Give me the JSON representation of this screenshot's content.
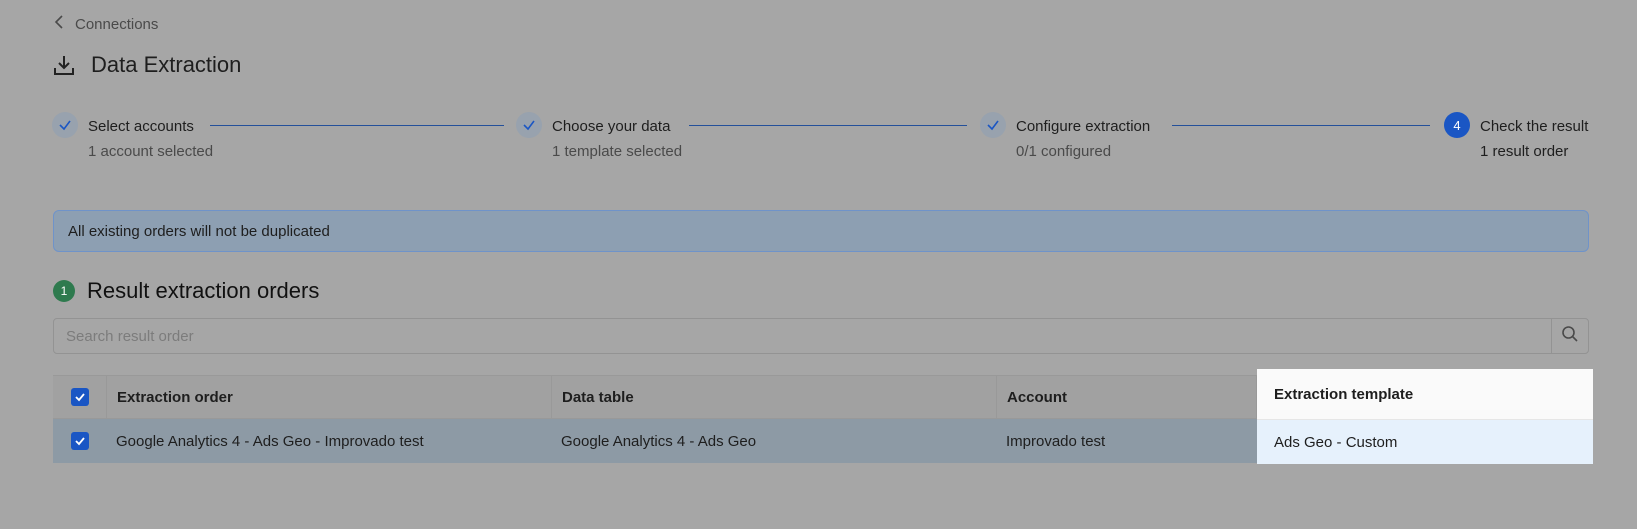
{
  "breadcrumb": {
    "back_label": "Connections"
  },
  "page": {
    "title": "Data Extraction"
  },
  "steps": [
    {
      "label": "Select accounts",
      "sub": "1 account selected",
      "status": "done"
    },
    {
      "label": "Choose your data",
      "sub": "1 template selected",
      "status": "done"
    },
    {
      "label": "Configure extraction",
      "sub": "0/1 configured",
      "status": "done"
    },
    {
      "label": "Check the result",
      "sub": "1 result order",
      "status": "current",
      "number": "4"
    }
  ],
  "notice": {
    "text": "All existing orders will not be duplicated"
  },
  "section": {
    "count": "1",
    "title": "Result extraction orders"
  },
  "search": {
    "placeholder": "Search result order",
    "value": ""
  },
  "table": {
    "columns": [
      "Extraction order",
      "Data table",
      "Account",
      "Extraction template"
    ],
    "rows": [
      {
        "order": "Google Analytics 4 - Ads Geo - Improvado test",
        "data_table": "Google Analytics 4 - Ads Geo",
        "account": "Improvado test",
        "template": "Ads Geo - Custom",
        "checked": true
      }
    ],
    "all_checked": true
  },
  "colors": {
    "accent": "#1a56c4",
    "success": "#2e7a4e",
    "highlight_row": "#e6f1fc"
  }
}
